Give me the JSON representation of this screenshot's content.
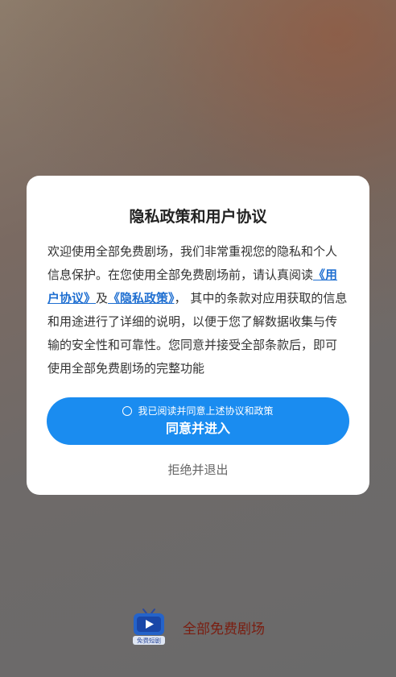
{
  "dialog": {
    "title": "隐私政策和用户协议",
    "body": {
      "intro": "欢迎使用全部免费剧场，我们非常重视您的隐私和个人信息保护。在您使用全部免费剧场前，请认真阅读",
      "user_agreement_link": "《用户协议》",
      "conjunction": "及",
      "privacy_policy_link": "《隐私政策》",
      "rest": "，  其中的条款对应用获取的信息和用途进行了详细的说明，以便于您了解数据收集与传输的安全性和可靠性。您同意并接受全部条款后，即可使用全部免费剧场的完整功能"
    },
    "consent_checkbox_label": "我已阅读并同意上述协议和政策",
    "agree_button_label": "同意并进入",
    "reject_label": "拒绝并退出"
  },
  "footer": {
    "app_name": "全部免费剧场",
    "logo_text": "免费短剧",
    "logo_icon": "tv-play-icon"
  },
  "colors": {
    "primary_button": "#1a8cf0",
    "link": "#1f6fd1",
    "app_name": "#7a1d10"
  }
}
